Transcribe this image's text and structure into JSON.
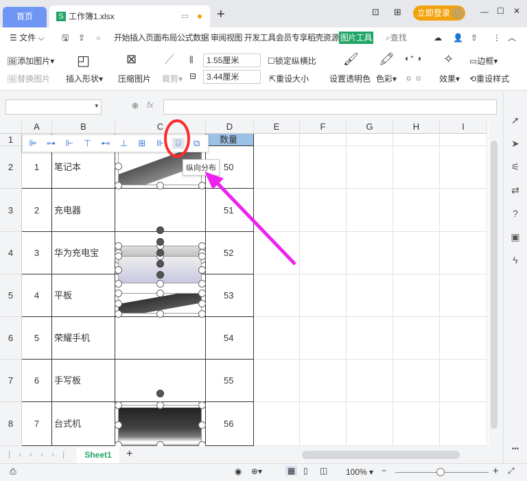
{
  "tabs": {
    "home": "首页",
    "doc": "工作簿1.xlsx",
    "new": "+"
  },
  "titlebar": {
    "login": "立即登录"
  },
  "menu": {
    "file": "文件",
    "items": [
      "开始",
      "插入",
      "页面布局",
      "公式",
      "数据",
      "审阅",
      "视图",
      "开发工具",
      "会员专享",
      "稻壳资源"
    ],
    "active": "图片工具",
    "search": "查找"
  },
  "ribbon": {
    "add_picture": "添加图片",
    "replace_picture": "替换图片",
    "insert_shape": "插入形状",
    "compress": "压缩图片",
    "crop": "裁剪",
    "height": "1.55厘米",
    "width": "3.44厘米",
    "lock_ratio": "锁定纵横比",
    "reset_size": "重设大小",
    "transparent": "设置透明色",
    "color": "色彩",
    "effects": "效果",
    "border": "边框",
    "reset_style": "重设样式"
  },
  "formula": {
    "fx": "fx"
  },
  "columns": [
    "A",
    "B",
    "C",
    "D",
    "E",
    "F",
    "G",
    "H",
    "I"
  ],
  "rows": [
    {
      "num": "1",
      "a": "",
      "b": "",
      "d": "数量"
    },
    {
      "num": "2",
      "a": "1",
      "b": "笔记本",
      "d": "50"
    },
    {
      "num": "3",
      "a": "2",
      "b": "充电器",
      "d": "51"
    },
    {
      "num": "4",
      "a": "3",
      "b": "华为充电宝",
      "d": "52"
    },
    {
      "num": "5",
      "a": "4",
      "b": "平板",
      "d": "53"
    },
    {
      "num": "6",
      "a": "5",
      "b": "荣耀手机",
      "d": "54"
    },
    {
      "num": "7",
      "a": "6",
      "b": "手写板",
      "d": "55"
    },
    {
      "num": "8",
      "a": "7",
      "b": "台式机",
      "d": "56"
    }
  ],
  "tooltip": "纵向分布",
  "sheet": {
    "name": "Sheet1"
  },
  "status": {
    "zoom": "100%"
  },
  "colors": {
    "accent": "#1fa463",
    "annotation_circle": "#ff2a2a",
    "annotation_arrow": "#ee22ee",
    "login": "#f2a20c"
  }
}
